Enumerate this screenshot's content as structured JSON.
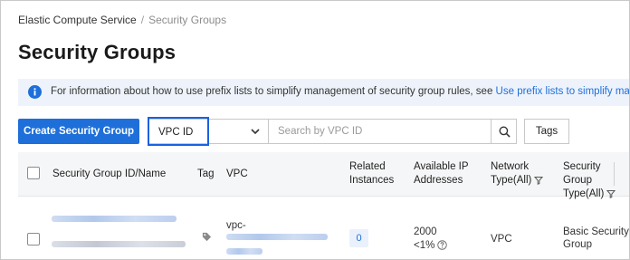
{
  "breadcrumb": {
    "parent": "Elastic Compute Service",
    "separator": "/",
    "current": "Security Groups"
  },
  "page_title": "Security Groups",
  "notice": {
    "text": "For information about how to use prefix lists to simplify management of security group rules, see",
    "link_text": "Use prefix lists to simplify management o"
  },
  "toolbar": {
    "create_label": "Create Security Group",
    "filter_select_value": "VPC ID",
    "search_placeholder": "Search by VPC ID",
    "tags_label": "Tags"
  },
  "table": {
    "headers": {
      "id_name": "Security Group ID/Name",
      "tag": "Tag",
      "vpc": "VPC",
      "related_1": "Related",
      "related_2": "Instances",
      "available_1": "Available IP",
      "available_2": "Addresses",
      "network_1": "Network",
      "network_2": "Type(All)",
      "sgtype_1": "Security Group",
      "sgtype_2": "Type(All)"
    },
    "rows": [
      {
        "vpc_prefix": "vpc-",
        "related_instances": "0",
        "available_ip": "2000",
        "available_ip_pct": "<1%",
        "network_type": "VPC",
        "sg_type_1": "Basic Security",
        "sg_type_2": "Group"
      }
    ]
  },
  "colors": {
    "primary": "#1e6fd9",
    "notice_bg": "#eef3fb",
    "highlight": "#1a62e0"
  },
  "icons": [
    "info-icon",
    "chevron-down-icon",
    "search-icon",
    "filter-icon",
    "tag-icon",
    "help-icon"
  ]
}
